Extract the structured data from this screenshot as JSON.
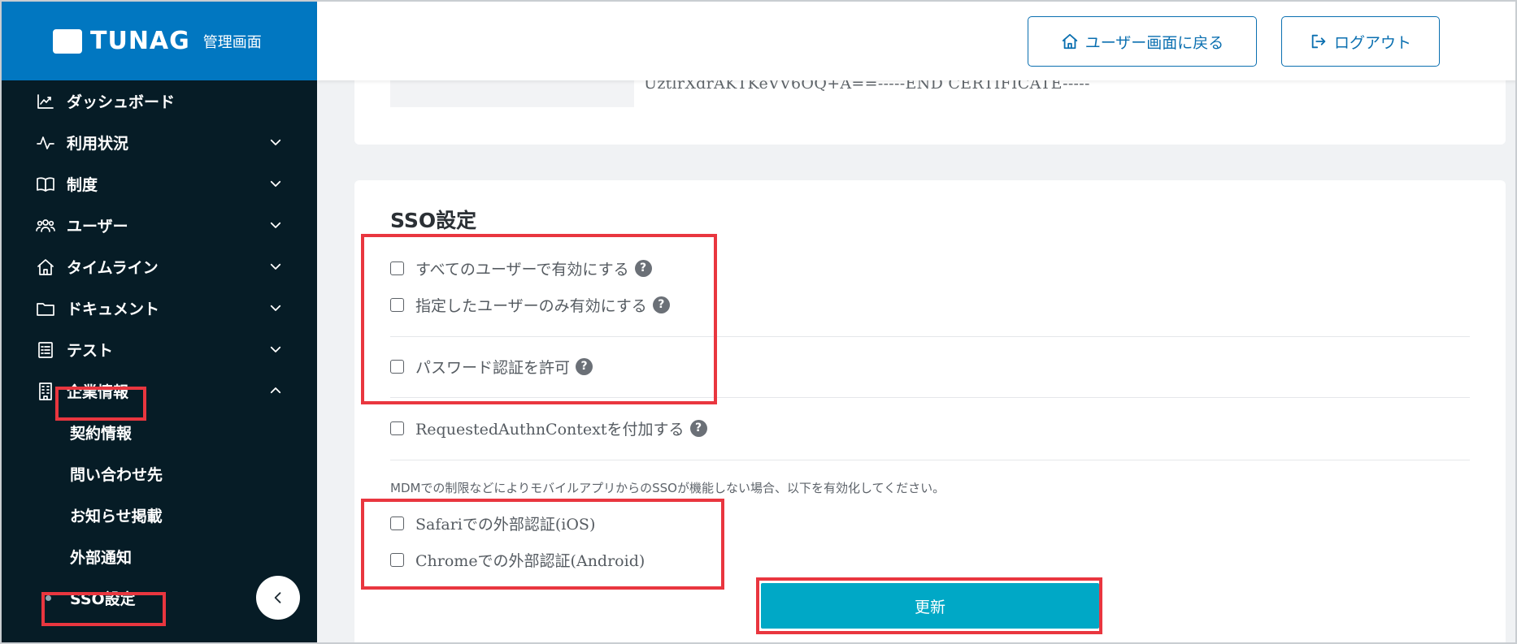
{
  "brand": {
    "name": "TUNAG",
    "subtitle": "管理画面"
  },
  "header": {
    "back_label": "ユーザー画面に戻る",
    "logout_label": "ログアウト"
  },
  "sidebar": {
    "items": [
      {
        "label": "ダッシュボード",
        "icon": "chart-icon"
      },
      {
        "label": "利用状況",
        "icon": "pulse-icon"
      },
      {
        "label": "制度",
        "icon": "book-icon"
      },
      {
        "label": "ユーザー",
        "icon": "users-icon"
      },
      {
        "label": "タイムライン",
        "icon": "home-icon"
      },
      {
        "label": "ドキュメント",
        "icon": "folder-icon"
      },
      {
        "label": "テスト",
        "icon": "checklist-icon"
      },
      {
        "label": "企業情報",
        "icon": "building-icon"
      }
    ],
    "sub_items": [
      {
        "label": "契約情報"
      },
      {
        "label": "問い合わせ先"
      },
      {
        "label": "お知らせ掲載"
      },
      {
        "label": "外部通知"
      },
      {
        "label": "SSO設定"
      }
    ]
  },
  "certificate": {
    "tail_text": "UztlrXdrAKTKeVV6OQ+A==-----END CERTIFICATE-----"
  },
  "sso": {
    "title": "SSO設定",
    "options": [
      {
        "label": "すべてのユーザーで有効にする"
      },
      {
        "label": "指定したユーザーのみ有効にする"
      },
      {
        "label": "パスワード認証を許可"
      },
      {
        "label": "RequestedAuthnContextを付加する"
      }
    ],
    "note": "MDMでの制限などによりモバイルアプリからのSSOが機能しない場合、以下を有効化してください。",
    "mobile_options": [
      {
        "label": "Safariでの外部認証(iOS)"
      },
      {
        "label": "Chromeでの外部認証(Android)"
      }
    ],
    "submit_label": "更新"
  },
  "colors": {
    "brand": "#0177c1",
    "sidebar": "#061c26",
    "accent": "#00a8c6",
    "highlight": "#e9363f"
  }
}
